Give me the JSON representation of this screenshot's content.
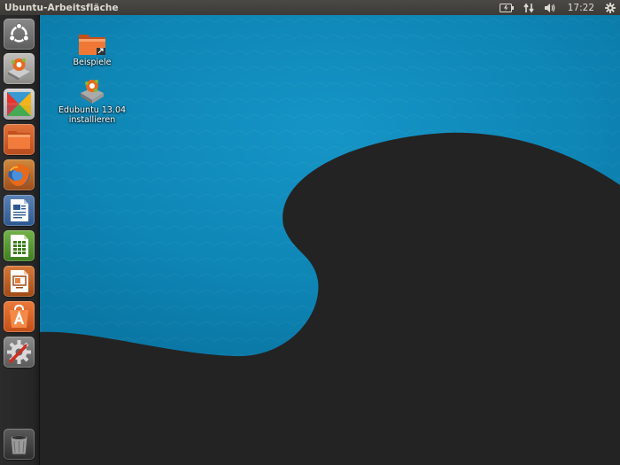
{
  "panel": {
    "title": "Ubuntu-Arbeitsfläche",
    "clock": "17:22",
    "indicators": [
      "battery-icon",
      "network-icon",
      "volume-icon",
      "session-gear-icon"
    ]
  },
  "launcher": {
    "items": [
      {
        "name": "dash-home",
        "icon": "ubuntu-logo-icon"
      },
      {
        "name": "edubuntu-installer",
        "icon": "installer-icon"
      },
      {
        "name": "xul-app",
        "icon": "colored-x-icon"
      },
      {
        "name": "home-folder",
        "icon": "folder-icon"
      },
      {
        "name": "firefox",
        "icon": "firefox-icon"
      },
      {
        "name": "libreoffice-writer",
        "icon": "writer-icon"
      },
      {
        "name": "libreoffice-calc",
        "icon": "calc-icon"
      },
      {
        "name": "libreoffice-impress",
        "icon": "impress-icon"
      },
      {
        "name": "ubuntu-software-center",
        "icon": "software-center-icon"
      },
      {
        "name": "system-settings",
        "icon": "settings-icon"
      },
      {
        "name": "trash",
        "icon": "trash-icon"
      }
    ]
  },
  "desktop": {
    "icons": [
      {
        "label": "Beispiele",
        "icon": "folder-icon"
      },
      {
        "label_line1": "Edubuntu 13.04",
        "label_line2": "installieren",
        "icon": "installer-icon"
      }
    ]
  },
  "colors": {
    "wallpaper_blue": "#0f88b9",
    "wallpaper_dark": "#232323",
    "panel": "#3c3b37",
    "accent_orange": "#dd4814"
  }
}
